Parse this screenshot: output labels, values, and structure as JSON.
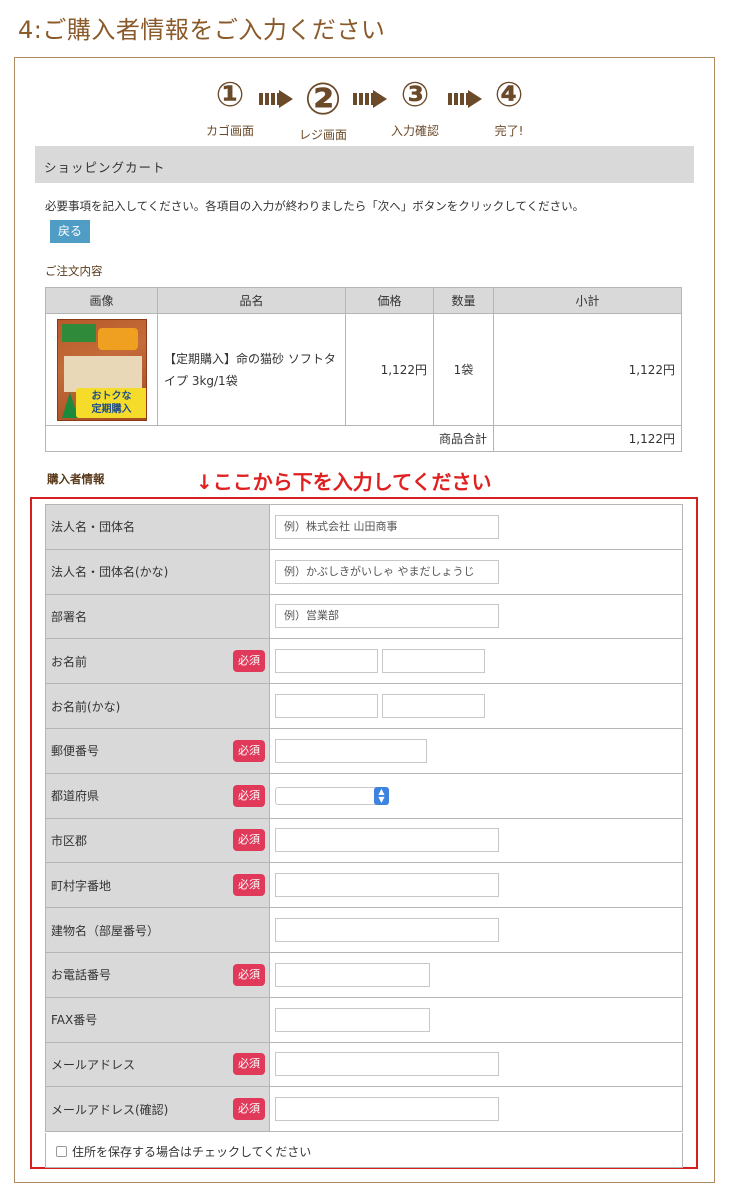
{
  "page_title": "4:ご購入者情報をご入力ください",
  "steps": [
    {
      "num": "①",
      "label": "カゴ画面"
    },
    {
      "num": "②",
      "label": "レジ画面"
    },
    {
      "num": "③",
      "label": "入力確認"
    },
    {
      "num": "④",
      "label": "完了!"
    }
  ],
  "cart_header": "ショッピングカート",
  "instruction": "必要事項を記入してください。各項目の入力が終わりましたら「次へ」ボタンをクリックしてください。",
  "back_label": "戻る",
  "order_section_label": "ご注文内容",
  "order_table": {
    "headers": [
      "画像",
      "品名",
      "価格",
      "数量",
      "小計"
    ],
    "item": {
      "image_badge": "おトクな 定期購入",
      "name": "【定期購入】命の猫砂 ソフトタイプ 3kg/1袋",
      "price": "1,122円",
      "qty": "1袋",
      "subtotal": "1,122円"
    },
    "total_label": "商品合計",
    "total_value": "1,122円"
  },
  "buyer_section_label": "購入者情報",
  "red_note": "↓ここから下を入力してください",
  "required_badge": "必須",
  "form": {
    "company": {
      "label": "法人名・団体名",
      "placeholder": "例）株式会社 山田商事"
    },
    "company_kana": {
      "label": "法人名・団体名(かな)",
      "placeholder": "例）かぶしきがいしゃ やまだしょうじ"
    },
    "department": {
      "label": "部署名",
      "placeholder": "例）営業部"
    },
    "name": {
      "label": "お名前"
    },
    "name_kana": {
      "label": "お名前(かな)"
    },
    "postal": {
      "label": "郵便番号"
    },
    "prefecture": {
      "label": "都道府県"
    },
    "city": {
      "label": "市区郡"
    },
    "street": {
      "label": "町村字番地"
    },
    "building": {
      "label": "建物名（部屋番号）"
    },
    "phone": {
      "label": "お電話番号"
    },
    "fax": {
      "label": "FAX番号"
    },
    "email": {
      "label": "メールアドレス"
    },
    "email_confirm": {
      "label": "メールアドレス(確認)"
    }
  },
  "save_address_label": "住所を保存する場合はチェックしてください",
  "colors": {
    "brand_brown": "#8b5a2b",
    "header_gray": "#d9d9d9",
    "back_button": "#4f9cc4",
    "required_badge": "#e0395a",
    "red_note": "#e02020"
  }
}
